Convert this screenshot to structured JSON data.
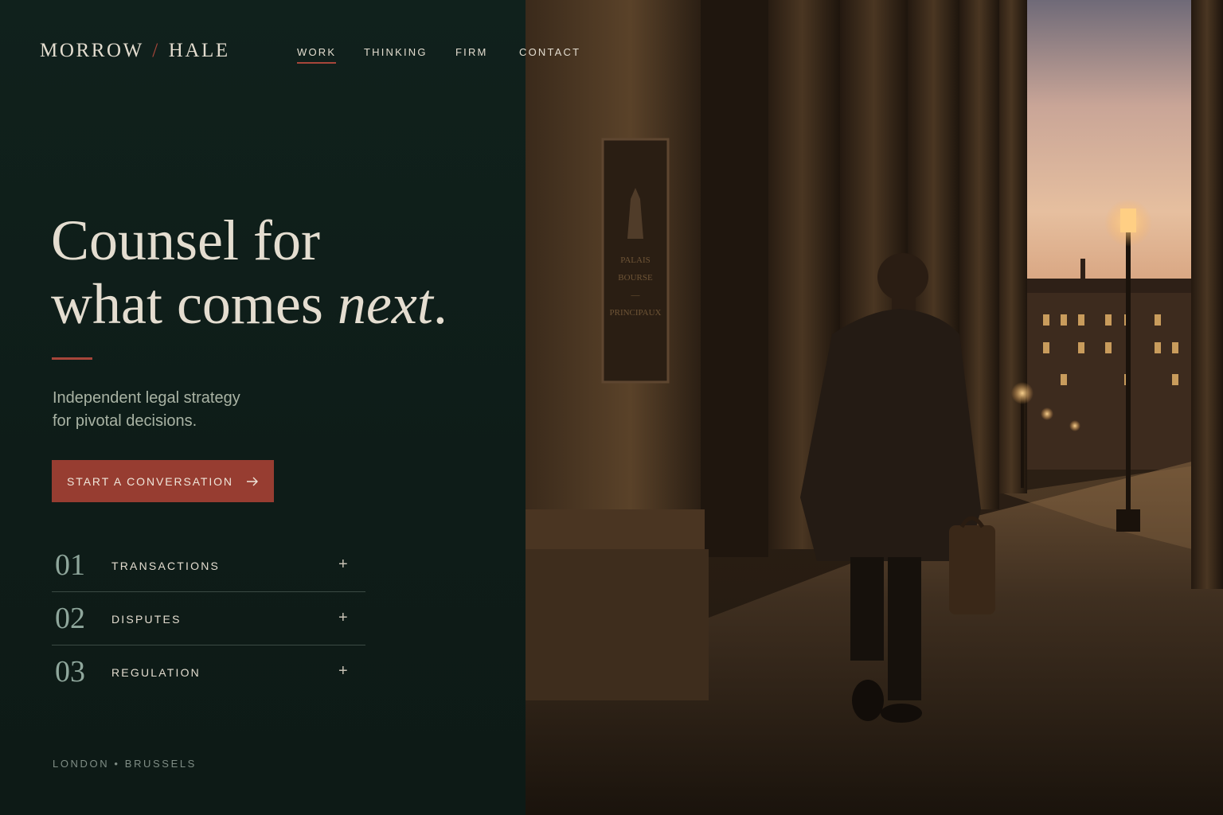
{
  "brand": {
    "name_left": "MORROW",
    "separator": "/",
    "name_right": "HALE"
  },
  "nav": {
    "items": [
      "WORK",
      "THINKING",
      "FIRM",
      "CONTACT"
    ],
    "active": "WORK"
  },
  "hero": {
    "line1": "Counsel for",
    "line2_plain": "what comes ",
    "line2_italic": "next",
    "line2_end": ".",
    "subline1": "Independent legal strategy",
    "subline2": "for pivotal decisions.",
    "cta_label": "START A CONVERSATION"
  },
  "practice_areas": [
    {
      "number": "01",
      "name": "TRANSACTIONS"
    },
    {
      "number": "02",
      "name": "DISPUTES"
    },
    {
      "number": "03",
      "name": "REGULATION"
    }
  ],
  "footer": {
    "offices": "LONDON  •  BRUSSELS"
  },
  "colors": {
    "panel": "#0f1d19",
    "accent": "#a7463a",
    "button": "#973d31",
    "text": "#e3dccf"
  },
  "photo": {
    "plaque_text": [
      "PALAIS",
      "BOURSE",
      "—",
      "PRINCIPAUX"
    ]
  }
}
